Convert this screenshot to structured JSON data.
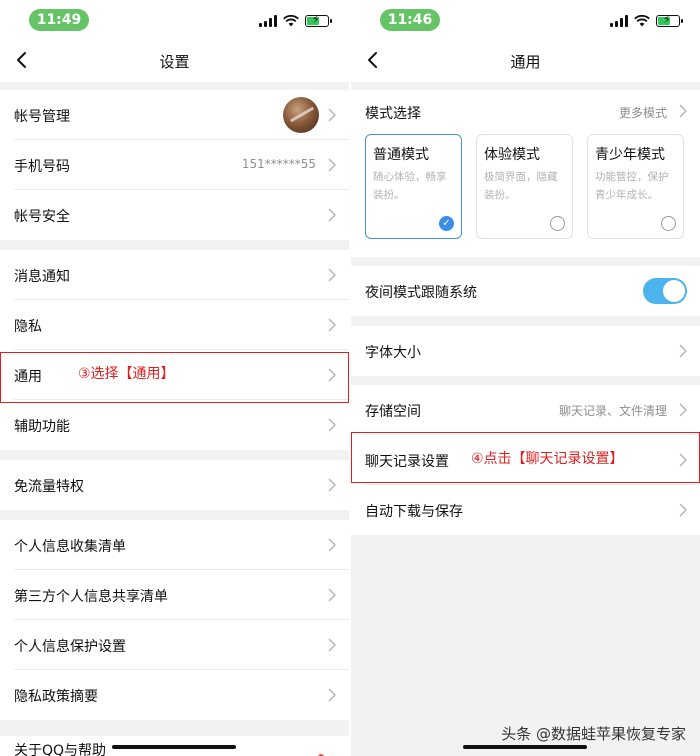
{
  "left": {
    "status_time": "11:49",
    "title": "设置",
    "rows": [
      {
        "label": "帐号管理"
      },
      {
        "label": "手机号码",
        "value": "151******55"
      },
      {
        "label": "帐号安全"
      },
      {
        "label": "消息通知"
      },
      {
        "label": "隐私"
      },
      {
        "label": "通用"
      },
      {
        "label": "辅助功能"
      },
      {
        "label": "免流量特权"
      },
      {
        "label": "个人信息收集清单"
      },
      {
        "label": "第三方个人信息共享清单"
      },
      {
        "label": "个人信息保护设置"
      },
      {
        "label": "隐私政策摘要"
      }
    ],
    "peek_label": "关于QQ与帮助",
    "annotation": "③选择【通用】"
  },
  "right": {
    "status_time": "11:46",
    "title": "通用",
    "mode_title": "模式选择",
    "mode_more": "更多模式",
    "modes": [
      {
        "name": "普通模式",
        "desc": "随心体验，畅享装扮。",
        "selected": true
      },
      {
        "name": "体验模式",
        "desc": "极简界面，隐藏装扮。",
        "selected": false
      },
      {
        "name": "青少年模式",
        "desc": "功能管控，保护青少年成长。",
        "selected": false
      }
    ],
    "rows": [
      {
        "label": "夜间模式跟随系统",
        "toggle": true
      },
      {
        "label": "字体大小"
      },
      {
        "label": "存储空间",
        "value": "聊天记录、文件清理"
      },
      {
        "label": "聊天记录设置"
      },
      {
        "label": "自动下载与保存"
      }
    ],
    "annotation": "④点击【聊天记录设置】"
  },
  "watermark": "头条 @数据蛙苹果恢复专家",
  "colors": {
    "annotation_red": "#e02020",
    "toggle_on": "#4db3ec",
    "selected_blue": "#3d8ee8",
    "time_pill": "#65c466"
  }
}
